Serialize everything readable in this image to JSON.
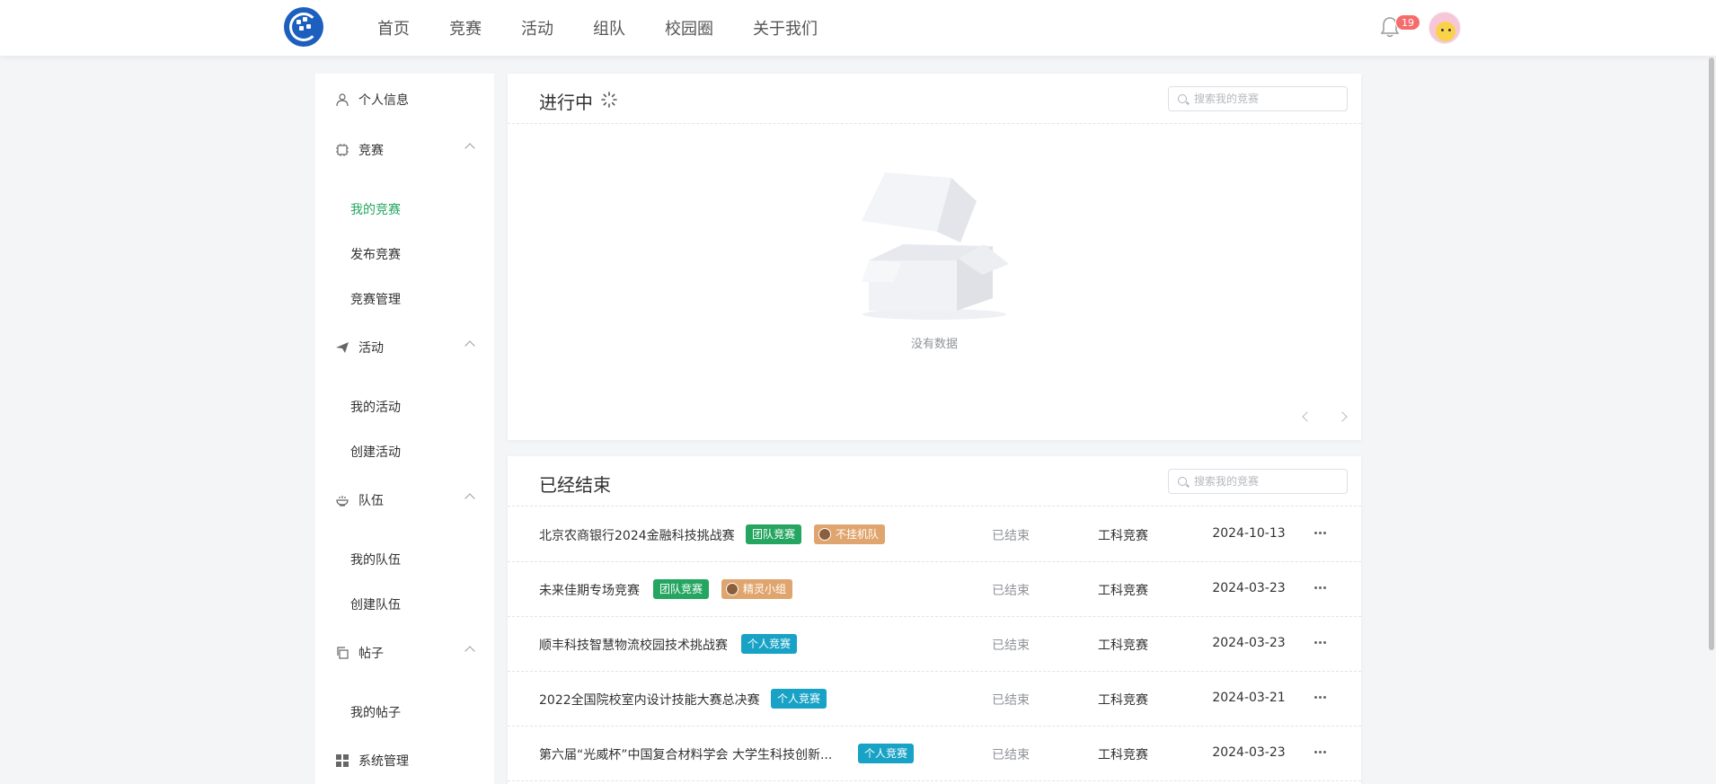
{
  "nav": {
    "items": [
      "首页",
      "竞赛",
      "活动",
      "组队",
      "校园圈",
      "关于我们"
    ],
    "notification_count": "19"
  },
  "sidebar": {
    "profile": "个人信息",
    "competition": {
      "label": "竞赛",
      "items": [
        "我的竞赛",
        "发布竞赛",
        "竞赛管理"
      ],
      "active": "我的竞赛"
    },
    "activity": {
      "label": "活动",
      "items": [
        "我的活动",
        "创建活动"
      ]
    },
    "team": {
      "label": "队伍",
      "items": [
        "我的队伍",
        "创建队伍"
      ]
    },
    "posts": {
      "label": "帖子",
      "items": [
        "我的帖子"
      ]
    },
    "system": "系统管理"
  },
  "ongoing": {
    "title": "进行中",
    "search_placeholder": "搜索我的竞赛",
    "empty_text": "没有数据"
  },
  "finished": {
    "title": "已经结束",
    "search_placeholder": "搜索我的竞赛",
    "rows": [
      {
        "name": "北京农商银行2024金融科技挑战赛",
        "tag": "团队竞赛",
        "tag_type": "team",
        "group": "不挂机队",
        "status": "已结束",
        "category": "工科竞赛",
        "date": "2024-10-13"
      },
      {
        "name": "未来佳期专场竞赛",
        "tag": "团队竞赛",
        "tag_type": "team",
        "group": "精灵小组",
        "status": "已结束",
        "category": "工科竞赛",
        "date": "2024-03-23"
      },
      {
        "name": "顺丰科技智慧物流校园技术挑战赛",
        "tag": "个人竞赛",
        "tag_type": "solo",
        "group": "",
        "status": "已结束",
        "category": "工科竞赛",
        "date": "2024-03-23"
      },
      {
        "name": "2022全国院校室内设计技能大赛总决赛",
        "tag": "个人竞赛",
        "tag_type": "solo",
        "group": "",
        "status": "已结束",
        "category": "工科竞赛",
        "date": "2024-03-21"
      },
      {
        "name": "第六届“光威杯”中国复合材料学会 大学生科技创新...",
        "tag": "个人竞赛",
        "tag_type": "solo",
        "group": "",
        "status": "已结束",
        "category": "工科竞赛",
        "date": "2024-03-23"
      }
    ]
  },
  "colors": {
    "accent": "#25a660",
    "solo_tag": "#17a2c6",
    "group_tag": "#e0a56e",
    "badge": "#f56c6c"
  }
}
